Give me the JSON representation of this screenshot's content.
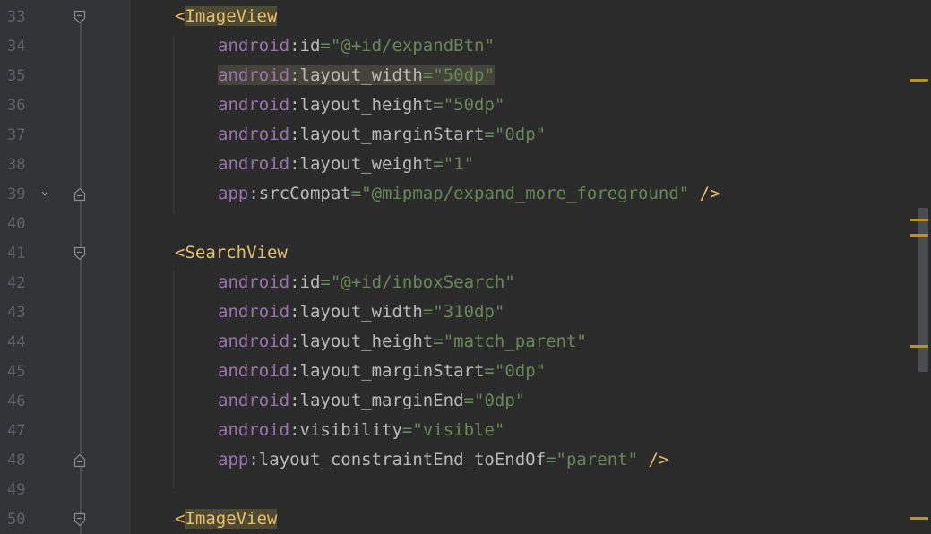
{
  "editor": {
    "lines": [
      {
        "num": "33",
        "parts": [
          {
            "t": "<",
            "c": "punct"
          },
          {
            "t": "ImageView",
            "c": "tag"
          }
        ],
        "indent": 1,
        "fold": "open",
        "hl": "tag"
      },
      {
        "num": "34",
        "parts": [
          {
            "t": "android",
            "c": "ns"
          },
          {
            "t": ":id",
            "c": "attr"
          },
          {
            "t": "=",
            "c": "eq"
          },
          {
            "t": "\"@+id/expandBtn\"",
            "c": "val"
          }
        ],
        "indent": 2
      },
      {
        "num": "35",
        "parts": [
          {
            "t": "android",
            "c": "ns"
          },
          {
            "t": ":layout_width",
            "c": "attr"
          },
          {
            "t": "=",
            "c": "eq"
          },
          {
            "t": "\"50dp\"",
            "c": "val"
          }
        ],
        "indent": 2,
        "hl": "attr"
      },
      {
        "num": "36",
        "parts": [
          {
            "t": "android",
            "c": "ns"
          },
          {
            "t": ":layout_height",
            "c": "attr"
          },
          {
            "t": "=",
            "c": "eq"
          },
          {
            "t": "\"50dp\"",
            "c": "val"
          }
        ],
        "indent": 2
      },
      {
        "num": "37",
        "parts": [
          {
            "t": "android",
            "c": "ns"
          },
          {
            "t": ":layout_marginStart",
            "c": "attr"
          },
          {
            "t": "=",
            "c": "eq"
          },
          {
            "t": "\"0dp\"",
            "c": "val"
          }
        ],
        "indent": 2
      },
      {
        "num": "38",
        "parts": [
          {
            "t": "android",
            "c": "ns"
          },
          {
            "t": ":layout_weight",
            "c": "attr"
          },
          {
            "t": "=",
            "c": "eq"
          },
          {
            "t": "\"1\"",
            "c": "val"
          }
        ],
        "indent": 2
      },
      {
        "num": "39",
        "parts": [
          {
            "t": "app",
            "c": "ns"
          },
          {
            "t": ":srcCompat",
            "c": "attr"
          },
          {
            "t": "=",
            "c": "eq"
          },
          {
            "t": "\"@mipmap/expand_more_foreground\"",
            "c": "val"
          },
          {
            "t": " />",
            "c": "punct"
          }
        ],
        "indent": 2,
        "fold": "close",
        "chevron": true
      },
      {
        "num": "40",
        "parts": [],
        "indent": 0
      },
      {
        "num": "41",
        "parts": [
          {
            "t": "<",
            "c": "punct"
          },
          {
            "t": "SearchView",
            "c": "tag"
          }
        ],
        "indent": 1,
        "fold": "open"
      },
      {
        "num": "42",
        "parts": [
          {
            "t": "android",
            "c": "ns"
          },
          {
            "t": ":id",
            "c": "attr"
          },
          {
            "t": "=",
            "c": "eq"
          },
          {
            "t": "\"@+id/inboxSearch\"",
            "c": "val"
          }
        ],
        "indent": 2
      },
      {
        "num": "43",
        "parts": [
          {
            "t": "android",
            "c": "ns"
          },
          {
            "t": ":layout_width",
            "c": "attr"
          },
          {
            "t": "=",
            "c": "eq"
          },
          {
            "t": "\"310dp\"",
            "c": "val"
          }
        ],
        "indent": 2
      },
      {
        "num": "44",
        "parts": [
          {
            "t": "android",
            "c": "ns"
          },
          {
            "t": ":layout_height",
            "c": "attr"
          },
          {
            "t": "=",
            "c": "eq"
          },
          {
            "t": "\"match_parent\"",
            "c": "val"
          }
        ],
        "indent": 2
      },
      {
        "num": "45",
        "parts": [
          {
            "t": "android",
            "c": "ns"
          },
          {
            "t": ":layout_marginStart",
            "c": "attr"
          },
          {
            "t": "=",
            "c": "eq"
          },
          {
            "t": "\"0dp\"",
            "c": "val"
          }
        ],
        "indent": 2
      },
      {
        "num": "46",
        "parts": [
          {
            "t": "android",
            "c": "ns"
          },
          {
            "t": ":layout_marginEnd",
            "c": "attr"
          },
          {
            "t": "=",
            "c": "eq"
          },
          {
            "t": "\"0dp\"",
            "c": "val"
          }
        ],
        "indent": 2
      },
      {
        "num": "47",
        "parts": [
          {
            "t": "android",
            "c": "ns"
          },
          {
            "t": ":visibility",
            "c": "attr"
          },
          {
            "t": "=",
            "c": "eq"
          },
          {
            "t": "\"visible\"",
            "c": "val"
          }
        ],
        "indent": 2
      },
      {
        "num": "48",
        "parts": [
          {
            "t": "app",
            "c": "ns"
          },
          {
            "t": ":layout_constraintEnd_toEndOf",
            "c": "attr"
          },
          {
            "t": "=",
            "c": "eq"
          },
          {
            "t": "\"parent\"",
            "c": "val"
          },
          {
            "t": " />",
            "c": "punct"
          }
        ],
        "indent": 2,
        "fold": "close"
      },
      {
        "num": "49",
        "parts": [],
        "indent": 0
      },
      {
        "num": "50",
        "parts": [
          {
            "t": "<",
            "c": "punct"
          },
          {
            "t": "ImageView",
            "c": "tag"
          }
        ],
        "indent": 1,
        "fold": "open",
        "hl": "tag"
      }
    ]
  },
  "colors": {
    "background": "#2b2b2b",
    "tag": "#e8bf6a",
    "namespace": "#9876aa",
    "attribute": "#bababa",
    "value": "#6a8759",
    "marker": "#be9117"
  }
}
